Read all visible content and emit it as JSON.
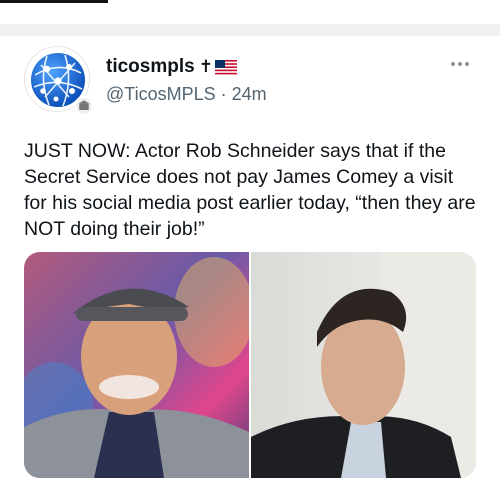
{
  "post": {
    "display_name": "ticosmpls",
    "name_emoji": "✝",
    "handle": "@TicosMPLS",
    "separator": "·",
    "time": "24m",
    "text": "JUST NOW: Actor Rob Schneider says that if the Secret Service does not pay James Comey a visit for his social media post earlier today, “then they are NOT doing their job!”",
    "more_icon": "more-horizontal-icon",
    "avatar_icon": "globe-network-icon"
  },
  "colors": {
    "text_primary": "#0f1419",
    "text_secondary": "#536471",
    "separator_bg": "#eff1f3",
    "avatar_blue": "#1e6fd1"
  }
}
